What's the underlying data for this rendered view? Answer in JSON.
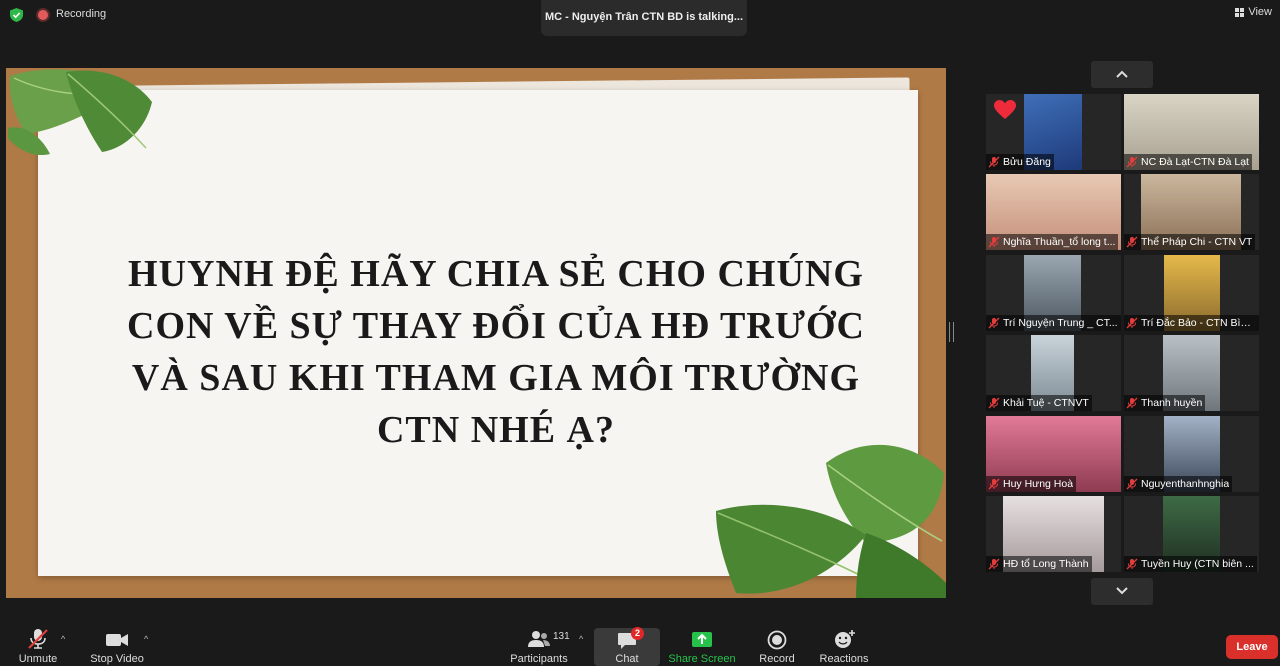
{
  "top_bar": {
    "recording_label": "Recording",
    "talking_indicator": "MC - Nguyện Trân CTN BD is talking...",
    "view_label": "View"
  },
  "slide": {
    "lines": [
      "HUYNH ĐỆ HÃY CHIA SẺ CHO CHÚNG",
      "CON VỀ SỰ THAY ĐỔI CỦA HĐ TRƯỚC",
      "VÀ SAU KHI THAM GIA MÔI TRƯỜNG",
      "CTN NHÉ Ạ?"
    ]
  },
  "gallery": {
    "participants": [
      {
        "name": "Bửu Đăng",
        "muted": true,
        "reaction": "heart"
      },
      {
        "name": "NC Đà Lạt-CTN Đà Lạt",
        "muted": true
      },
      {
        "name": "Nghĩa Thuần_tổ long t...",
        "muted": true
      },
      {
        "name": "Thể Pháp Chi - CTN VT",
        "muted": true
      },
      {
        "name": "Trí Nguyện Trung _ CT...",
        "muted": true
      },
      {
        "name": "Trí Đắc Bảo - CTN Bình...",
        "muted": true
      },
      {
        "name": "Khải Tuệ - CTNVT",
        "muted": true
      },
      {
        "name": "Thanh huyền",
        "muted": true
      },
      {
        "name": "Huy Hưng Hoà",
        "muted": true
      },
      {
        "name": "Nguyenthanhnghia",
        "muted": true
      },
      {
        "name": "HĐ tổ Long Thành",
        "muted": true
      },
      {
        "name": "Tuyền Huy (CTN biên ...",
        "muted": true
      }
    ]
  },
  "toolbar": {
    "unmute_label": "Unmute",
    "stop_video_label": "Stop Video",
    "participants_label": "Participants",
    "participants_count": "131",
    "chat_label": "Chat",
    "chat_badge": "2",
    "share_screen_label": "Share Screen",
    "record_label": "Record",
    "reactions_label": "Reactions",
    "leave_label": "Leave"
  },
  "colors": {
    "share_green": "#27c24c",
    "leave_red": "#d9302b",
    "slide_frame": "#b07a46",
    "muted_mic_red": "#e23c3c"
  }
}
